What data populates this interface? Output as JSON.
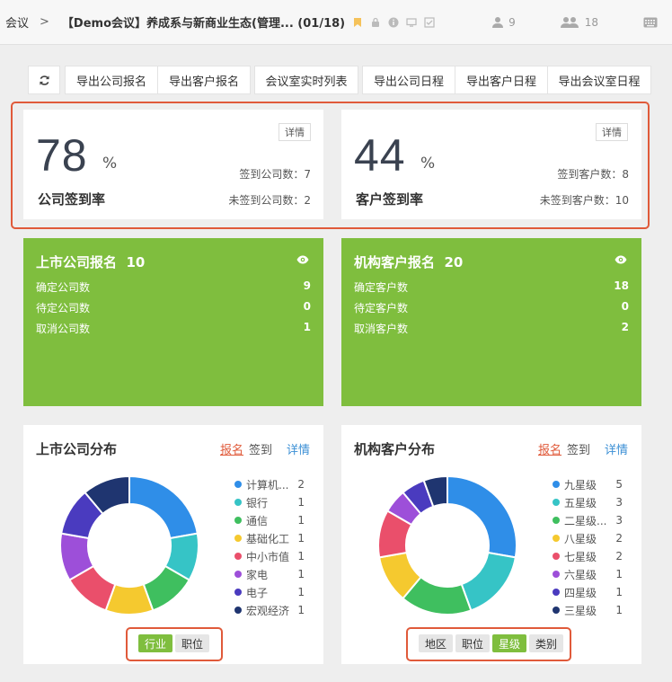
{
  "topbar": {
    "home": "会议",
    "separator": ">",
    "title": "【Demo会议】养成系与新商业生态(管理... (01/18)",
    "people_count": "9",
    "group_count": "18"
  },
  "toolbar": {
    "refresh_icon": "refresh-icon",
    "buttons": [
      "导出公司报名",
      "导出客户报名",
      "会议室实时列表",
      "导出公司日程",
      "导出客户日程",
      "导出会议室日程"
    ]
  },
  "company_rate": {
    "value": "78",
    "unit": "%",
    "label": "公司签到率",
    "detail": "详情",
    "signed": "签到公司数：7",
    "unsigned": "未签到公司数：2"
  },
  "client_rate": {
    "value": "44",
    "unit": "%",
    "label": "客户签到率",
    "detail": "详情",
    "signed": "签到客户数：8",
    "unsigned": "未签到客户数：10"
  },
  "listed_reg": {
    "title": "上市公司报名",
    "count": "10",
    "rows": [
      {
        "label": "确定公司数",
        "value": "9"
      },
      {
        "label": "待定公司数",
        "value": "0"
      },
      {
        "label": "取消公司数",
        "value": "1"
      }
    ]
  },
  "inst_reg": {
    "title": "机构客户报名",
    "count": "20",
    "rows": [
      {
        "label": "确定客户数",
        "value": "18"
      },
      {
        "label": "待定客户数",
        "value": "0"
      },
      {
        "label": "取消客户数",
        "value": "2"
      }
    ]
  },
  "listed_dist": {
    "title": "上市公司分布",
    "link_reg": "报名",
    "link_sign": "签到",
    "link_detail": "详情",
    "tags": [
      {
        "label": "行业",
        "active": true
      },
      {
        "label": "职位",
        "active": false
      }
    ]
  },
  "inst_dist": {
    "title": "机构客户分布",
    "link_reg": "报名",
    "link_sign": "签到",
    "link_detail": "详情",
    "tags": [
      {
        "label": "地区",
        "active": false
      },
      {
        "label": "职位",
        "active": false
      },
      {
        "label": "星级",
        "active": true
      },
      {
        "label": "类别",
        "active": false
      }
    ]
  },
  "chart_data": [
    {
      "type": "pie",
      "donut": true,
      "categories": [
        "计算机...",
        "银行",
        "通信",
        "基础化工",
        "中小市值",
        "家电",
        "电子",
        "宏观经济"
      ],
      "values": [
        2,
        1,
        1,
        1,
        1,
        1,
        1,
        1
      ],
      "colors": [
        "#2f8ee8",
        "#36c4c6",
        "#3fbf5f",
        "#f5c92f",
        "#ea4f6b",
        "#9d4fd9",
        "#4a3bbf",
        "#1f3570"
      ],
      "legend": "right"
    },
    {
      "type": "pie",
      "donut": true,
      "categories": [
        "九星级",
        "五星级",
        "二星级...",
        "八星级",
        "七星级",
        "六星级",
        "四星级",
        "三星级"
      ],
      "values": [
        5,
        3,
        3,
        2,
        2,
        1,
        1,
        1
      ],
      "colors": [
        "#2f8ee8",
        "#36c4c6",
        "#3fbf5f",
        "#f5c92f",
        "#ea4f6b",
        "#9d4fd9",
        "#4a3bbf",
        "#1f3570"
      ],
      "legend": "right"
    }
  ]
}
